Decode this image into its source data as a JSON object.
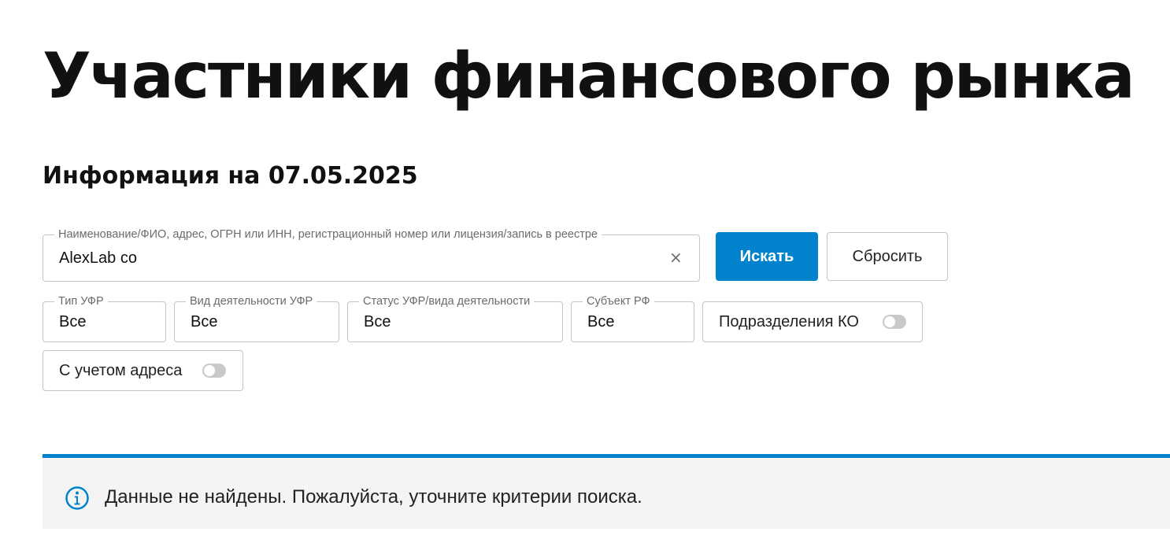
{
  "header": {
    "title": "Участники финансового рынка",
    "info_date": "Информация на 07.05.2025"
  },
  "search": {
    "label": "Наименование/ФИО, адрес, ОГРН или ИНН, регистрационный номер или лицензия/запись в реестре",
    "value": "AlexLab co",
    "clear_glyph": "×",
    "search_button": "Искать",
    "reset_button": "Сбросить"
  },
  "filters": {
    "type": {
      "label": "Тип УФР",
      "value": "Все"
    },
    "activity": {
      "label": "Вид деятельности УФР",
      "value": "Все"
    },
    "status": {
      "label": "Статус УФР/вида деятельности",
      "value": "Все"
    },
    "region": {
      "label": "Субъект РФ",
      "value": "Все"
    }
  },
  "toggles": {
    "ko_divisions": {
      "label": "Подразделения КО",
      "checked": false
    },
    "with_address": {
      "label": "С учетом адреса",
      "checked": false
    }
  },
  "result": {
    "message": "Данные не найдены. Пожалуйста, уточните критерии поиска.",
    "icon": "info-icon"
  },
  "colors": {
    "accent": "#0083cc",
    "panel_bg": "#f4f4f4",
    "border": "#c4c4c4",
    "toggle_off": "#c9c9c9"
  }
}
